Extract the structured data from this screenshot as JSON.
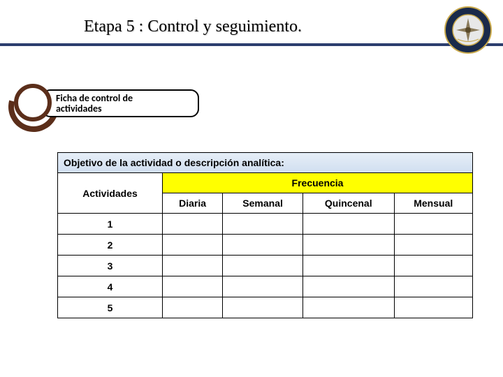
{
  "header": {
    "title": "Etapa 5 : Control y seguimiento.",
    "logo_alt": "Aviación del Ejército emblem"
  },
  "ficha": {
    "label_line1": "Ficha  de control de",
    "label_line2": "actividades"
  },
  "table": {
    "objetivo_label": "Objetivo de la actividad o descripción analítica:",
    "actividades_label": "Actividades",
    "frecuencia_label": "Frecuencia",
    "freq_cols": [
      "Diaria",
      "Semanal",
      "Quincenal",
      "Mensual"
    ],
    "rows": [
      "1",
      "2",
      "3",
      "4",
      "5"
    ]
  },
  "chart_data": {
    "type": "table",
    "title": "Ficha de control de actividades — Frecuencia",
    "columns": [
      "Actividades",
      "Diaria",
      "Semanal",
      "Quincenal",
      "Mensual"
    ],
    "rows": [
      {
        "Actividades": "1",
        "Diaria": "",
        "Semanal": "",
        "Quincenal": "",
        "Mensual": ""
      },
      {
        "Actividades": "2",
        "Diaria": "",
        "Semanal": "",
        "Quincenal": "",
        "Mensual": ""
      },
      {
        "Actividades": "3",
        "Diaria": "",
        "Semanal": "",
        "Quincenal": "",
        "Mensual": ""
      },
      {
        "Actividades": "4",
        "Diaria": "",
        "Semanal": "",
        "Quincenal": "",
        "Mensual": ""
      },
      {
        "Actividades": "5",
        "Diaria": "",
        "Semanal": "",
        "Quincenal": "",
        "Mensual": ""
      }
    ]
  }
}
